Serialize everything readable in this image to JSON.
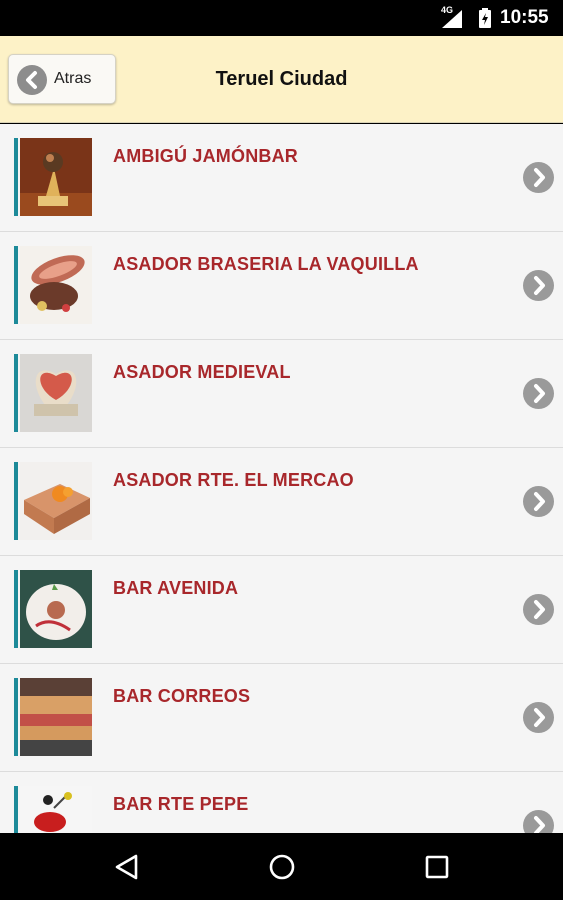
{
  "status_bar": {
    "network": "4G",
    "time": "10:55",
    "icons": [
      "signal-icon",
      "battery-charging-icon"
    ]
  },
  "header": {
    "back_label": "Atras",
    "title": "Teruel Ciudad",
    "colors": {
      "background": "#fdf2c7"
    }
  },
  "list": {
    "colors": {
      "name_text": "#a8272b",
      "accent": "#1d8a99",
      "chevron": "#9a9a9a"
    },
    "items": [
      {
        "name": "AMBIGÚ JAMÓNBAR"
      },
      {
        "name": "ASADOR BRASERIA LA VAQUILLA"
      },
      {
        "name": "ASADOR MEDIEVAL"
      },
      {
        "name": "ASADOR RTE. EL MERCAO"
      },
      {
        "name": "BAR AVENIDA"
      },
      {
        "name": "BAR CORREOS"
      },
      {
        "name": "BAR RTE PEPE"
      }
    ]
  },
  "nav_bar": {
    "icons": [
      "back-triangle-icon",
      "home-circle-icon",
      "recents-square-icon"
    ]
  }
}
